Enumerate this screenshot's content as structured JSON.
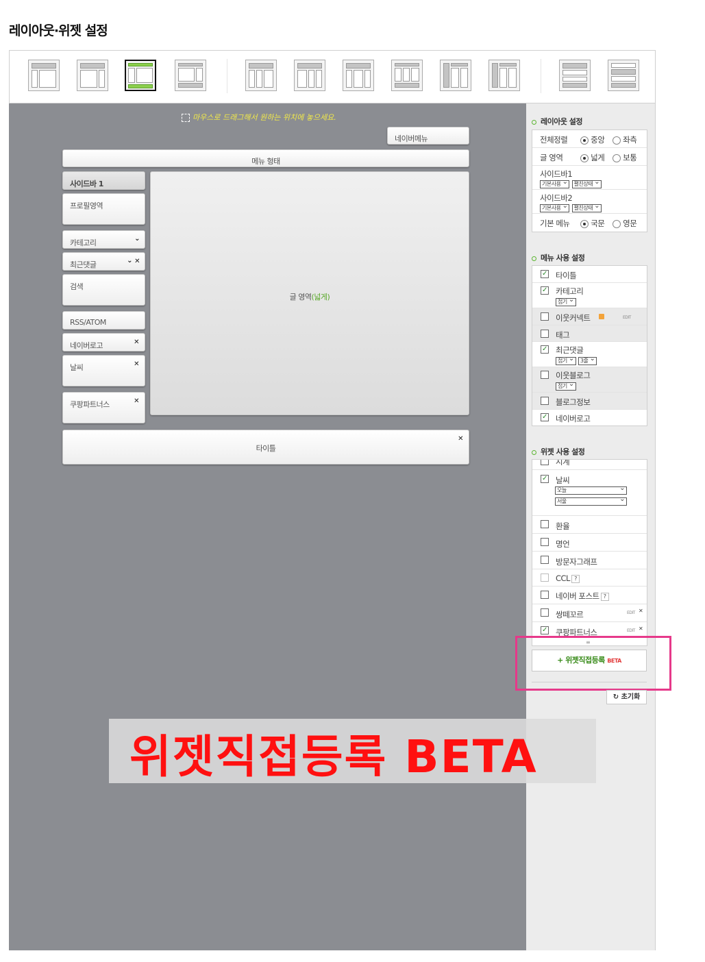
{
  "page_title": "레이아웃·위젯 설정",
  "canvas": {
    "hint": "마우스로 드래그해서 원하는 위치에 놓으세요.",
    "naver_menu": "네이버메뉴",
    "menu_form": "메뉴 형태",
    "sidebar_header": "사이드바 1",
    "sidebar_items": {
      "profile": "프로필영역",
      "category": "카테고리",
      "recent_comments": "최근댓글",
      "search": "검색",
      "rss": "RSS/ATOM",
      "naver_logo": "네이버로고",
      "weather": "날씨",
      "coupang": "쿠팡파트너스"
    },
    "main_area_prefix": "글 영역",
    "main_area_suffix": "(넓게)",
    "title_bar": "타이틀"
  },
  "layout_settings": {
    "title": "레이아웃 설정",
    "align_label": "전체정렬",
    "align_opt1": "중앙",
    "align_opt2": "좌측",
    "area_label": "글 영역",
    "area_opt1": "넓게",
    "area_opt2": "보통",
    "sidebar1_label": "사이드바1",
    "sidebar1_sel1": "기본사용",
    "sidebar1_sel2": "펼친상태",
    "sidebar2_label": "사이드바2",
    "sidebar2_sel1": "기본사용",
    "sidebar2_sel2": "펼친상태",
    "basic_menu_label": "기본 메뉴",
    "basic_menu_opt1": "국문",
    "basic_menu_opt2": "영문"
  },
  "menu_settings": {
    "title": "메뉴 사용 설정",
    "title_item": "타이틀",
    "category": "카테고리",
    "category_sel": "접기",
    "neighbor_connect": "이웃커넥트",
    "edit": "EDIT",
    "tag": "태그",
    "recent_comments": "최근댓글",
    "recent_sel1": "접기",
    "recent_sel2": "3줄",
    "neighbor_blog": "이웃블로그",
    "neighbor_sel": "접기",
    "blog_info": "블로그정보",
    "naver_logo": "네이버로고"
  },
  "widget_settings": {
    "title": "위젯 사용 설정",
    "clock": "시계",
    "weather": "날씨",
    "weather_sel1": "오늘",
    "weather_sel2": "서울",
    "exchange": "환율",
    "quote": "명언",
    "visitor_graph": "방문자그래프",
    "ccl": "CCL",
    "naver_post": "네이버 포스트",
    "ssangttekkoreu": "쌍떼꼬르",
    "coupang": "쿠팡파트너스",
    "edit": "EDIT",
    "q": "?"
  },
  "add_widget": {
    "plus": "+",
    "label": "위젯직접등록",
    "beta": "BETA"
  },
  "reset": "초기화",
  "overlay_caption": "위젯직접등록 BETA",
  "colors": {
    "canvas": "#8b8d92",
    "accent_green": "#5cb531",
    "highlight_pink": "#e6398a",
    "caption_red": "#ff1010"
  }
}
